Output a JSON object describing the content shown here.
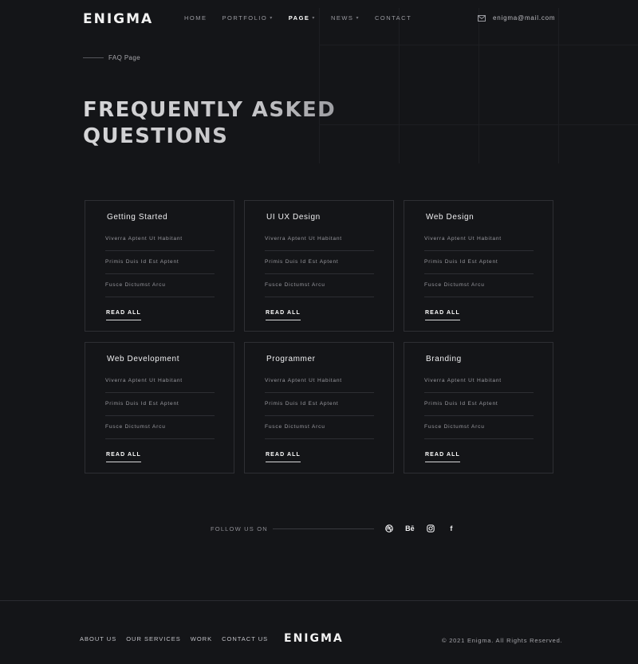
{
  "header": {
    "logo": "ENIGMA",
    "nav": [
      {
        "label": "HOME",
        "dropdown": false,
        "active": false
      },
      {
        "label": "PORTFOLIO",
        "dropdown": true,
        "active": false
      },
      {
        "label": "PAGE",
        "dropdown": true,
        "active": true
      },
      {
        "label": "NEWS",
        "dropdown": true,
        "active": false
      },
      {
        "label": "CONTACT",
        "dropdown": false,
        "active": false
      }
    ],
    "email": "enigma@mail.com",
    "email_icon": "mail-icon"
  },
  "breadcrumb": {
    "label": "FAQ Page"
  },
  "title": {
    "line1": "Frequently Asked",
    "line2": "Questions"
  },
  "cards": [
    {
      "title": "Getting Started",
      "items": [
        "Viverra Aptent Ut Habitant",
        "Primis Duis Id Est Aptent",
        "Fusce Dictumst Arcu"
      ],
      "link": "READ ALL"
    },
    {
      "title": "UI UX Design",
      "items": [
        "Viverra Aptent Ut Habitant",
        "Primis Duis Id Est Aptent",
        "Fusce Dictumst Arcu"
      ],
      "link": "READ ALL"
    },
    {
      "title": "Web Design",
      "items": [
        "Viverra Aptent Ut Habitant",
        "Primis Duis Id Est Aptent",
        "Fusce Dictumst Arcu"
      ],
      "link": "READ ALL"
    },
    {
      "title": "Web Development",
      "items": [
        "Viverra Aptent Ut Habitant",
        "Primis Duis Id Est Aptent",
        "Fusce Dictumst Arcu"
      ],
      "link": "READ ALL"
    },
    {
      "title": "Programmer",
      "items": [
        "Viverra Aptent Ut Habitant",
        "Primis Duis Id Est Aptent",
        "Fusce Dictumst Arcu"
      ],
      "link": "READ ALL"
    },
    {
      "title": "Branding",
      "items": [
        "Viverra Aptent Ut Habitant",
        "Primis Duis Id Est Aptent",
        "Fusce Dictumst Arcu"
      ],
      "link": "READ ALL"
    }
  ],
  "follow": {
    "label": "FOLLOW US ON",
    "icons": [
      {
        "name": "dribbble-icon",
        "glyph": ""
      },
      {
        "name": "behance-icon",
        "glyph": "Bē"
      },
      {
        "name": "instagram-icon",
        "glyph": ""
      },
      {
        "name": "facebook-icon",
        "glyph": "f"
      }
    ]
  },
  "footer": {
    "links": [
      "ABOUT US",
      "OUR SERVICES",
      "WORK",
      "CONTACT US"
    ],
    "logo": "ENIGMA",
    "copyright": "© 2021 Enigma. All Rights Reserved."
  },
  "colors": {
    "background": "#141518",
    "card_border": "#2e2f34",
    "text_primary": "#f0f0f2",
    "text_muted": "#9a9aa0"
  }
}
